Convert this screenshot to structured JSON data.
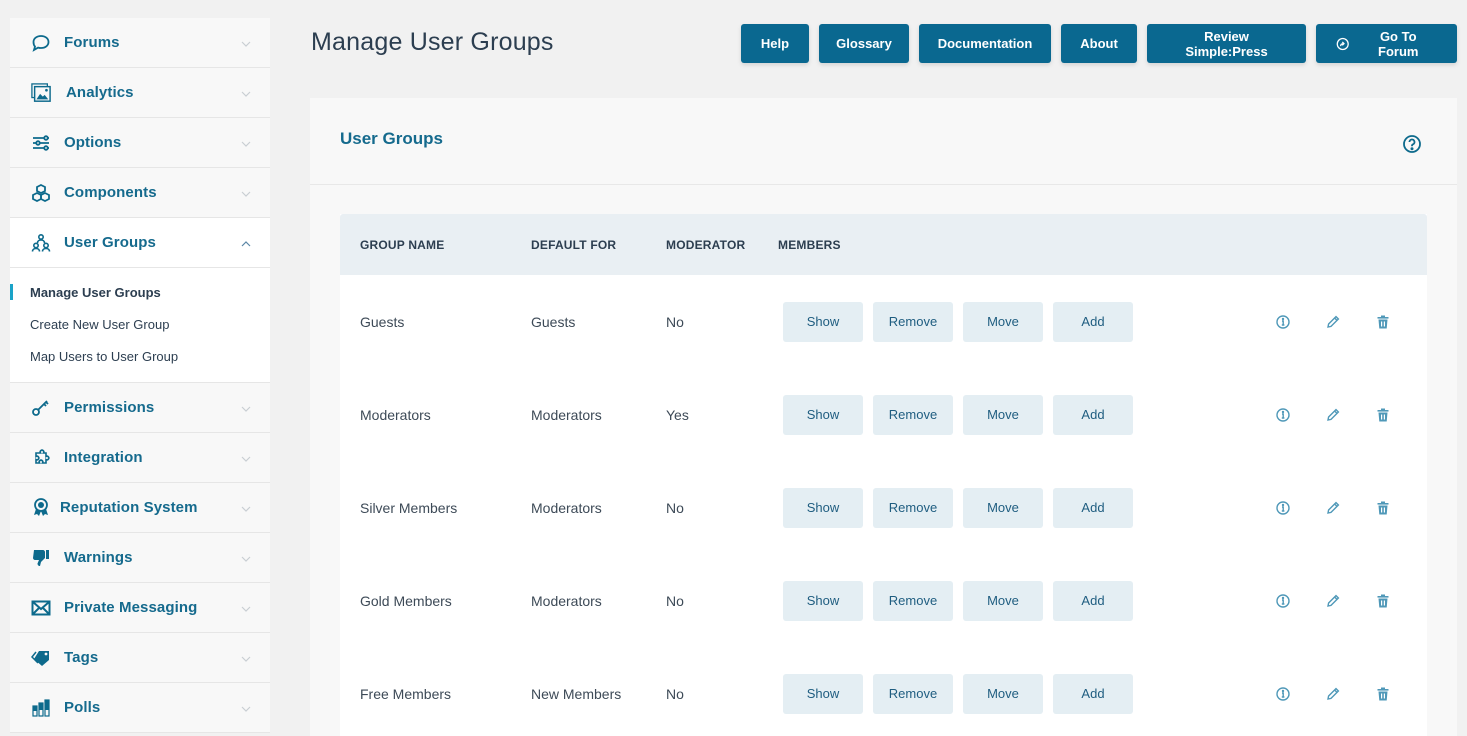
{
  "sidebar": {
    "items_top": [
      {
        "label": "Forums",
        "icon": "chat-bubble-icon"
      },
      {
        "label": "Analytics",
        "icon": "image-icon"
      },
      {
        "label": "Options",
        "icon": "sliders-icon"
      },
      {
        "label": "Components",
        "icon": "cubes-icon"
      },
      {
        "label": "User Groups",
        "icon": "users-group-icon",
        "expanded": true
      }
    ],
    "submenu": [
      {
        "label": "Manage User Groups",
        "active": true
      },
      {
        "label": "Create New User Group"
      },
      {
        "label": "Map Users to User Group"
      }
    ],
    "items_bottom": [
      {
        "label": "Permissions",
        "icon": "key-icon"
      },
      {
        "label": "Integration",
        "icon": "puzzle-icon"
      },
      {
        "label": "Reputation System",
        "icon": "award-icon"
      },
      {
        "label": "Warnings",
        "icon": "thumbs-down-icon"
      },
      {
        "label": "Private Messaging",
        "icon": "envelope-icon"
      },
      {
        "label": "Tags",
        "icon": "tags-icon"
      },
      {
        "label": "Polls",
        "icon": "bar-chart-icon"
      }
    ]
  },
  "header": {
    "title": "Manage User Groups",
    "buttons": {
      "help": "Help",
      "glossary": "Glossary",
      "documentation": "Documentation",
      "about": "About",
      "review": "Review Simple:Press",
      "forum": "Go To Forum"
    }
  },
  "panel": {
    "title": "User Groups",
    "columns": [
      "GROUP NAME",
      "DEFAULT FOR",
      "MODERATOR",
      "MEMBERS"
    ],
    "member_actions": [
      "Show",
      "Remove",
      "Move",
      "Add"
    ],
    "rows": [
      {
        "name": "Guests",
        "default_for": "Guests",
        "moderator": "No"
      },
      {
        "name": "Moderators",
        "default_for": "Moderators",
        "moderator": "Yes"
      },
      {
        "name": "Silver Members",
        "default_for": "Moderators",
        "moderator": "No"
      },
      {
        "name": "Gold Members",
        "default_for": "Moderators",
        "moderator": "No"
      },
      {
        "name": "Free Members",
        "default_for": "New Members",
        "moderator": "No"
      }
    ]
  },
  "colors": {
    "primary": "#0a6890",
    "accent": "#1aa3c8",
    "button_light": "#e4eef3",
    "table_header": "#e9eff3"
  }
}
